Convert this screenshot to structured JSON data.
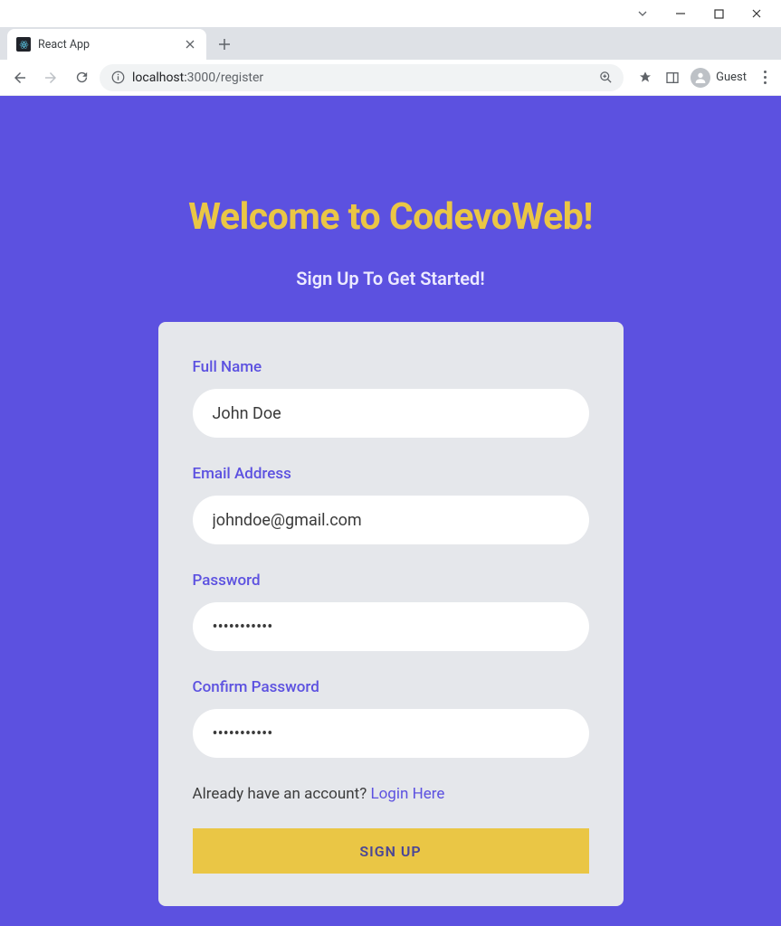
{
  "window": {
    "tab_title": "React App",
    "url_host": "localhost:",
    "url_port_path": "3000/register",
    "guest_label": "Guest"
  },
  "page": {
    "headline": "Welcome to CodevoWeb!",
    "subhead": "Sign Up To Get Started!"
  },
  "form": {
    "fullname_label": "Full Name",
    "fullname_value": "John Doe",
    "email_label": "Email Address",
    "email_value": "johndoe@gmail.com",
    "password_label": "Password",
    "password_value": "•••••••••••",
    "confirm_label": "Confirm Password",
    "confirm_value": "•••••••••••",
    "login_prompt": "Already have an account? ",
    "login_link": "Login Here",
    "submit_label": "SIGN UP"
  }
}
